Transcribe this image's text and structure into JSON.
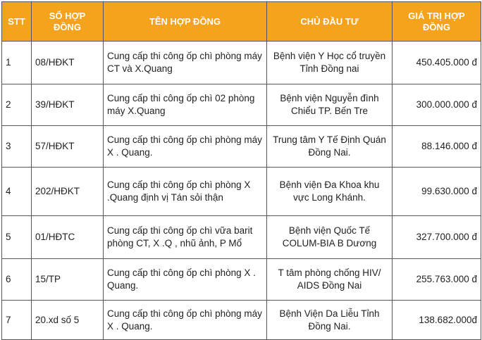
{
  "headers": {
    "stt": "STT",
    "contract_no": "SỐ HỢP ĐỒNG",
    "contract_name": "TÊN HỢP ĐỒNG",
    "investor": "CHỦ ĐẦU TƯ",
    "value": "GIÁ TRỊ HỢP ĐỒNG"
  },
  "rows": [
    {
      "stt": "1",
      "contract_no": "08/HĐKT",
      "name": "Cung cấp thi công ốp chì phòng máy CT và X.Quang",
      "investor": "Bệnh viện Y Học cổ truyền Tỉnh Đồng nai",
      "value": "450.405.000 đ"
    },
    {
      "stt": "2",
      "contract_no": "39/HĐKT",
      "name": "Cung cấp thi công ốp chì 02 phòng máy X.Quang",
      "investor": "Bệnh viện Nguyễn đình Chiểu TP. Bến Tre",
      "value": "300.000.000 đ"
    },
    {
      "stt": "3",
      "contract_no": "57/HĐKT",
      "name": "Cung cấp thi công ốp chì phòng máy X . Quang.",
      "investor": "Trung tâm Y Tế Định Quán Đồng Nai.",
      "value": "88.146.000 đ"
    },
    {
      "stt": "4",
      "contract_no": "202/HĐKT",
      "name": "Cung cấp thi công ốp chì phòng X .Quang định vị Tán sỏi thận",
      "investor": "Bệnh viện Đa Khoa khu vực Long Khánh.",
      "value": "99.630.000 đ"
    },
    {
      "stt": "5",
      "contract_no": "01/HĐTC",
      "name": "Cung cấp thi công ốp chì vữa barit phòng CT, X .Q , nhũ ảnh, P Mổ",
      "investor": "Bệnh viện Quốc Tế COLUM-BIA B Dương",
      "value": "327.700.000 đ"
    },
    {
      "stt": "6",
      "contract_no": "15/TP",
      "name": "Cung cấp thi  công ốp chì phòng X . Quang.",
      "investor": "T tâm phòng chống HIV/ AIDS Đồng Nai",
      "value": "255.763.000 đ"
    },
    {
      "stt": "7",
      "contract_no": "20.xd số 5",
      "name": "Cung cấp thi công ốp chì phòng máy X . Quang.",
      "investor": "Bệnh Viện Da Liễu Tỉnh Đồng Nai.",
      "value": "138.682.000đ"
    }
  ]
}
